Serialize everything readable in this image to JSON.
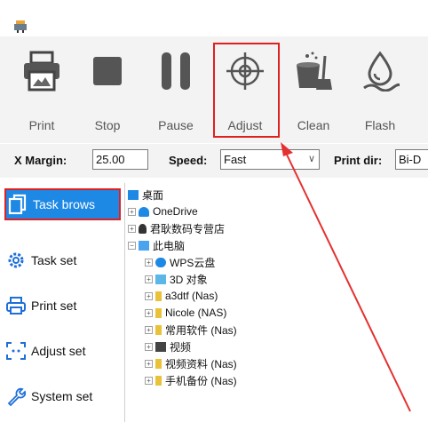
{
  "toolbar": {
    "buttons": [
      {
        "name": "print",
        "label": "Print",
        "icon": "printer-icon"
      },
      {
        "name": "stop",
        "label": "Stop",
        "icon": "stop-icon"
      },
      {
        "name": "pause",
        "label": "Pause",
        "icon": "pause-icon"
      },
      {
        "name": "adjust",
        "label": "Adjust",
        "icon": "crosshair-icon"
      },
      {
        "name": "clean",
        "label": "Clean",
        "icon": "cleaning-bucket-icon"
      },
      {
        "name": "flash",
        "label": "Flash",
        "icon": "ink-drop-icon"
      }
    ]
  },
  "settings": {
    "x_margin_label": "X Margin:",
    "x_margin_value": "25.00",
    "speed_label": "Speed:",
    "speed_value": "Fast",
    "print_dir_label": "Print dir:",
    "print_dir_value": "Bi-D"
  },
  "sidebar": {
    "items": [
      {
        "label": "Task brows",
        "icon": "copy-files-icon",
        "active": true
      },
      {
        "label": "Task set",
        "icon": "gear-icon"
      },
      {
        "label": "Print set",
        "icon": "printer-icon"
      },
      {
        "label": "Adjust set",
        "icon": "adjust-frame-icon"
      },
      {
        "label": "System set",
        "icon": "wrench-icon"
      }
    ]
  },
  "tree": {
    "nodes": [
      {
        "label": "桌面",
        "icon": "desktop-icon"
      },
      {
        "label": "OneDrive",
        "icon": "cloud-icon"
      },
      {
        "label": "君耿数码专营店",
        "icon": "user-icon"
      },
      {
        "label": "此电脑",
        "icon": "computer-icon"
      },
      {
        "label": "WPS云盘",
        "icon": "cloud-icon"
      },
      {
        "label": "3D 对象",
        "icon": "3d-objects-icon"
      },
      {
        "label": "a3dtf (Nas)",
        "icon": "network-drive-icon"
      },
      {
        "label": "Nicole (NAS)",
        "icon": "network-drive-icon"
      },
      {
        "label": "常用软件 (Nas)",
        "icon": "network-drive-icon"
      },
      {
        "label": "视频",
        "icon": "video-folder-icon"
      },
      {
        "label": "视频资料 (Nas)",
        "icon": "network-drive-icon"
      },
      {
        "label": "手机备份 (Nas)",
        "icon": "network-drive-icon"
      }
    ]
  },
  "colors": {
    "accent": "#1e88e5",
    "highlight": "#e02020",
    "toolbar_bg": "#f3f3f3"
  }
}
